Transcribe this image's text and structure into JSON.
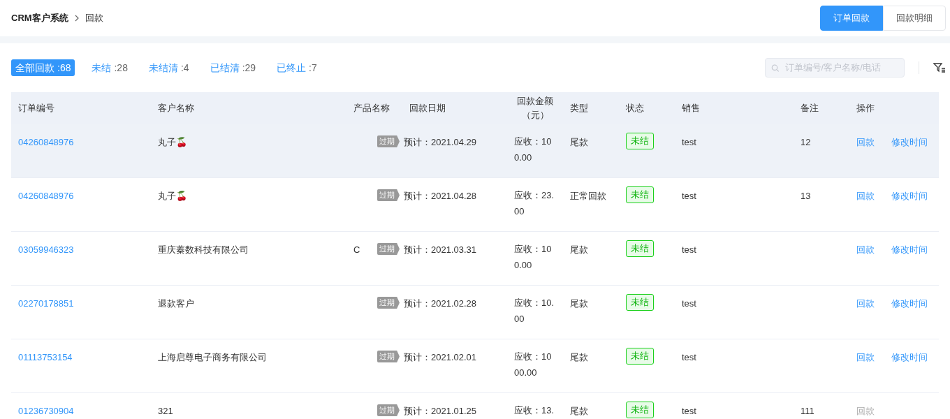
{
  "breadcrumb": [
    "CRM客户系统",
    "回款"
  ],
  "view_switch": [
    {
      "label": "订单回款",
      "selected": true
    },
    {
      "label": "回款明细",
      "selected": false
    }
  ],
  "filters": [
    {
      "label": "全部回款",
      "count": ":68",
      "selected": true
    },
    {
      "label": "未结",
      "count": ":28",
      "selected": false
    },
    {
      "label": "未结清",
      "count": ":4",
      "selected": false
    },
    {
      "label": "已结清",
      "count": ":29",
      "selected": false
    },
    {
      "label": "已终止",
      "count": ":7",
      "selected": false
    }
  ],
  "search": {
    "placeholder": "订单编号/客户名称/电话"
  },
  "table": {
    "columns": [
      "订单编号",
      "客户名称",
      "产品名称",
      "回款日期",
      "回款金额（元）",
      "类型",
      "状态",
      "销售",
      "备注",
      "操作"
    ],
    "rows": [
      {
        "order_no": "04260848976",
        "customer": "丸子🍒",
        "product": "",
        "overdue": "过期",
        "date": "预计：2021.04.29",
        "amount": "应收：100.00",
        "type": "尾款",
        "status": "未结",
        "sales": "test",
        "note": "12",
        "actions": [
          {
            "label": "回款",
            "disabled": false
          },
          {
            "label": "修改时间",
            "disabled": false
          }
        ],
        "selected": true
      },
      {
        "order_no": "04260848976",
        "customer": "丸子🍒",
        "product": "",
        "overdue": "过期",
        "date": "预计：2021.04.28",
        "amount": "应收：23.00",
        "type": "正常回款",
        "status": "未结",
        "sales": "test",
        "note": "13",
        "actions": [
          {
            "label": "回款",
            "disabled": false
          },
          {
            "label": "修改时间",
            "disabled": false
          }
        ],
        "selected": false
      },
      {
        "order_no": "03059946323",
        "customer": "重庆蓁数科技有限公司",
        "product": "C",
        "overdue": "过期",
        "date": "预计：2021.03.31",
        "amount": "应收：100.00",
        "type": "尾款",
        "status": "未结",
        "sales": "test",
        "note": "",
        "actions": [
          {
            "label": "回款",
            "disabled": false
          },
          {
            "label": "修改时间",
            "disabled": false
          }
        ],
        "selected": false
      },
      {
        "order_no": "02270178851",
        "customer": "退款客户",
        "product": "",
        "overdue": "过期",
        "date": "预计：2021.02.28",
        "amount": "应收：10.00",
        "type": "尾款",
        "status": "未结",
        "sales": "test",
        "note": "",
        "actions": [
          {
            "label": "回款",
            "disabled": false
          },
          {
            "label": "修改时间",
            "disabled": false
          }
        ],
        "selected": false
      },
      {
        "order_no": "01113753154",
        "customer": "上海启尊电子商务有限公司",
        "product": "",
        "overdue": "过期",
        "date": "预计：2021.02.01",
        "amount": "应收：1000.00",
        "type": "尾款",
        "status": "未结",
        "sales": "test",
        "note": "",
        "actions": [
          {
            "label": "回款",
            "disabled": false
          },
          {
            "label": "修改时间",
            "disabled": false
          }
        ],
        "selected": false
      },
      {
        "order_no": "01236730904",
        "customer": "321",
        "product": "",
        "overdue": "过期",
        "date": "预计：2021.01.25",
        "amount": "应收：13.",
        "type": "尾款",
        "status": "未结",
        "sales": "test",
        "note": "111",
        "actions": [
          {
            "label": "回款",
            "disabled": true
          }
        ],
        "selected": false
      }
    ]
  }
}
